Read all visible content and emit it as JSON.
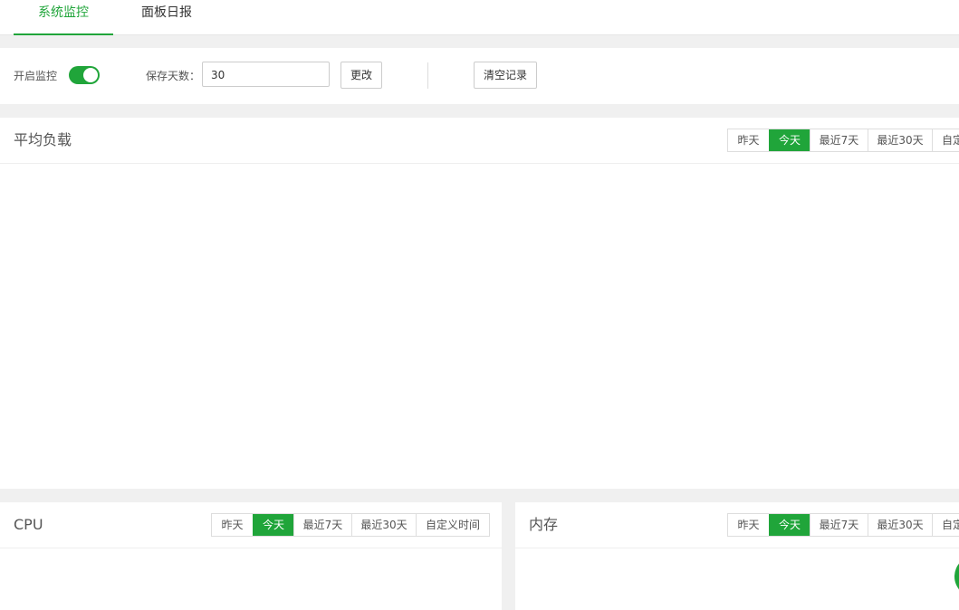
{
  "tabs": [
    {
      "label": "系统监控",
      "active": true
    },
    {
      "label": "面板日报",
      "active": false
    }
  ],
  "settings": {
    "enable_label": "开启监控",
    "enabled": true,
    "keep_days_label": "保存天数：",
    "keep_days_value": "30",
    "change_button": "更改",
    "clear_button": "清空记录"
  },
  "panels": {
    "load": {
      "title": "平均负载",
      "options": [
        "昨天",
        "今天",
        "最近7天",
        "最近30天",
        "自定义时间"
      ],
      "active_index": 1
    },
    "cpu": {
      "title": "CPU",
      "options": [
        "昨天",
        "今天",
        "最近7天",
        "最近30天",
        "自定义时间"
      ],
      "active_index": 1
    },
    "mem": {
      "title": "内存",
      "options": [
        "昨天",
        "今天",
        "最近7天",
        "最近30天",
        "自定义时间"
      ],
      "active_index": 1
    }
  },
  "colors": {
    "accent": "#20a53a",
    "background": "#f0f0f0",
    "panel": "#ffffff"
  }
}
